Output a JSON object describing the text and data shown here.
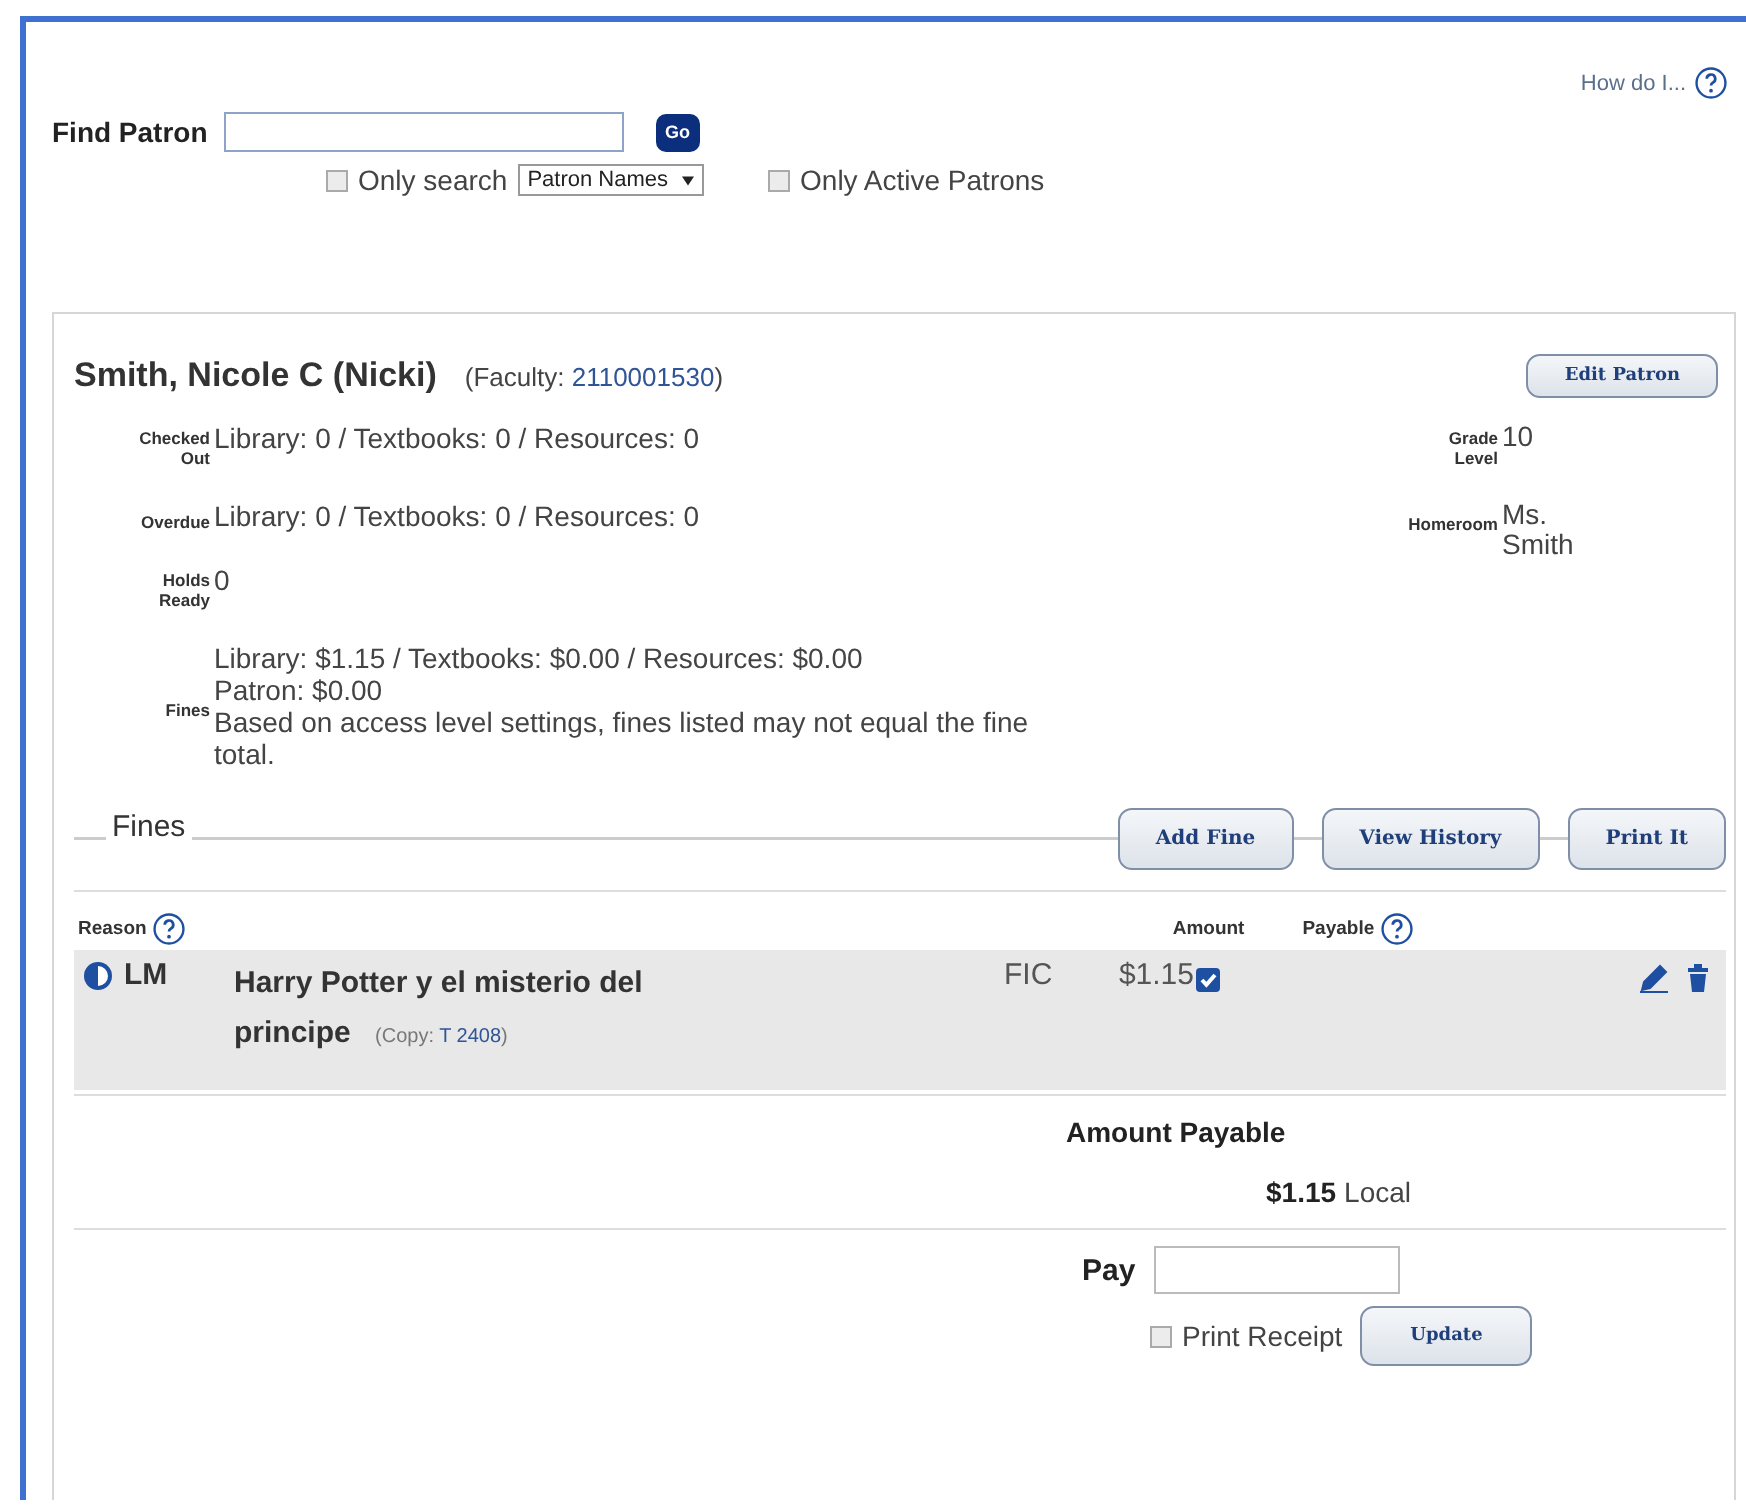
{
  "help_link": {
    "label": "How do I..."
  },
  "search": {
    "label": "Find Patron",
    "go": "Go",
    "only_search": {
      "label": "Only search",
      "checked": false
    },
    "search_type": "Patron Names",
    "only_active": {
      "label": "Only Active Patrons",
      "checked": false
    }
  },
  "patron": {
    "name": "Smith, Nicole C (Nicki)",
    "type": "(Faculty: ",
    "barcode": "2110001530",
    "type_end": ")",
    "edit_button": "Edit Patron",
    "stats": [
      {
        "label": "Checked Out",
        "lines": [
          "Library: 0 / Textbooks: 0 / Resources: 0"
        ]
      },
      {
        "label": "Overdue",
        "lines": [
          "Library: 0 / Textbooks: 0 / Resources: 0"
        ]
      },
      {
        "label": "Holds Ready",
        "lines": [
          "0"
        ]
      },
      {
        "label": "Fines",
        "lines": [
          "Library: $1.15 / Textbooks: $0.00 / Resources: $0.00",
          "Patron: $0.00",
          "Based on access level settings, fines listed may not equal the fine total."
        ]
      }
    ],
    "details": [
      {
        "label": "Grade Level",
        "value": "10"
      },
      {
        "label": "Homeroom",
        "value": "Ms. Smith"
      }
    ]
  },
  "fines": {
    "title": "Fines",
    "buttons": [
      "Add Fine",
      "View History",
      "Print It"
    ],
    "columns": {
      "reason": "Reason",
      "amount": "Amount",
      "payable": "Payable"
    },
    "rows": [
      {
        "code": "LM",
        "title": "Harry Potter y el misterio del principe",
        "copy_prefix": "(Copy: ",
        "copy": "T 2408",
        "copy_end": ")",
        "collection": "FIC",
        "amount": "$1.15",
        "payable": true
      }
    ],
    "amount_payable": {
      "label": "Amount Payable",
      "value": "$1.15",
      "scope": "Local"
    },
    "pay": {
      "label": "Pay",
      "print_receipt": {
        "label": "Print Receipt",
        "checked": false
      },
      "update": "Update"
    }
  }
}
